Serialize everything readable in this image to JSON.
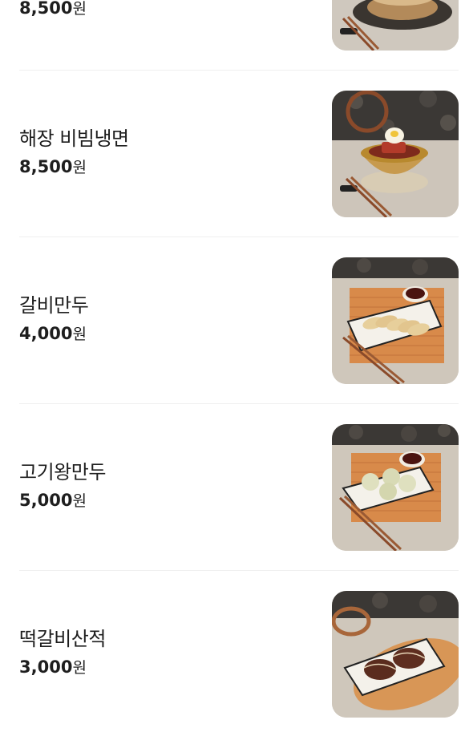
{
  "menu": {
    "items": [
      {
        "name": "",
        "price": "8,500",
        "currency": "원",
        "photo": "bowl-on-stone-plate"
      },
      {
        "name": "해장 비빔냉면",
        "price": "8,500",
        "currency": "원",
        "photo": "bibim-naengmyeon"
      },
      {
        "name": "갈비만두",
        "price": "4,000",
        "currency": "원",
        "photo": "galbi-mandu"
      },
      {
        "name": "고기왕만두",
        "price": "5,000",
        "currency": "원",
        "photo": "gogi-wang-mandu"
      },
      {
        "name": "떡갈비산적",
        "price": "3,000",
        "currency": "원",
        "photo": "tteokgalbi-sanjeok"
      }
    ]
  },
  "colors": {
    "text": "#1e1e1e",
    "divider": "#efefef",
    "background": "#ffffff"
  }
}
